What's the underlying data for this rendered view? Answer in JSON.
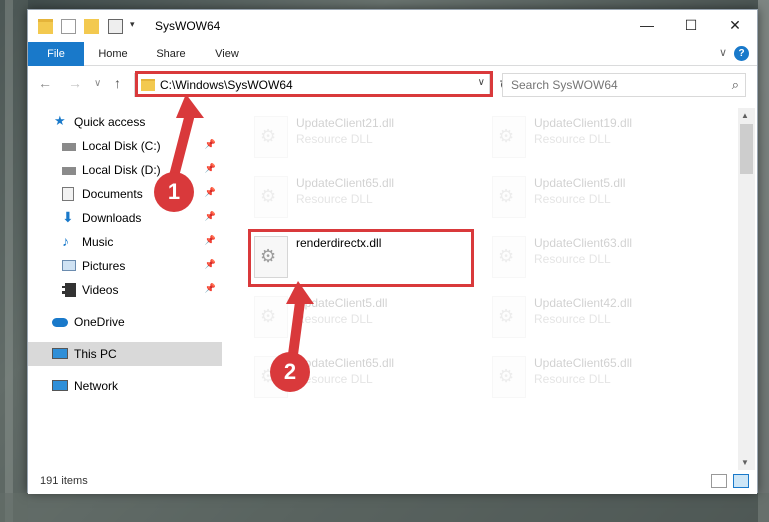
{
  "window": {
    "title": "SysWOW64",
    "minimize": "—",
    "maximize": "☐",
    "close": "✕"
  },
  "ribbon": {
    "tabs": [
      "File",
      "Home",
      "Share",
      "View"
    ],
    "help": "?",
    "collapse": "∨"
  },
  "nav": {
    "back": "←",
    "forward": "→",
    "recent": "∨",
    "up": "↑",
    "address": "C:\\Windows\\SysWOW64",
    "address_dropdown": "∨",
    "refresh": "↻",
    "search_placeholder": "Search SysWOW64",
    "search_icon": "⌕"
  },
  "sidebar": {
    "items": [
      {
        "label": "Quick access",
        "icon": "star-icon",
        "pinned": false
      },
      {
        "label": "Local Disk (C:)",
        "icon": "drive-icon",
        "pinned": true
      },
      {
        "label": "Local Disk (D:)",
        "icon": "drive-icon",
        "pinned": true
      },
      {
        "label": "Documents",
        "icon": "documents-icon",
        "pinned": true
      },
      {
        "label": "Downloads",
        "icon": "download-icon",
        "pinned": true
      },
      {
        "label": "Music",
        "icon": "music-icon",
        "pinned": true
      },
      {
        "label": "Pictures",
        "icon": "pictures-icon",
        "pinned": true
      },
      {
        "label": "Videos",
        "icon": "videos-icon",
        "pinned": true
      },
      {
        "label": "OneDrive",
        "icon": "cloud-icon",
        "pinned": false
      },
      {
        "label": "This PC",
        "icon": "computer-icon",
        "pinned": false,
        "selected": true
      },
      {
        "label": "Network",
        "icon": "network-icon",
        "pinned": false
      }
    ],
    "pin_glyph": "📌"
  },
  "files": [
    {
      "name": "UpdateClient21.dll",
      "type": "Resource DLL",
      "faded": true
    },
    {
      "name": "UpdateClient19.dll",
      "type": "Resource DLL",
      "faded": true
    },
    {
      "name": "UpdateClient65.dll",
      "type": "Resource DLL",
      "faded": true
    },
    {
      "name": "UpdateClient5.dll",
      "type": "Resource DLL",
      "faded": true
    },
    {
      "name": "renderdirectx.dll",
      "type": "",
      "faded": false
    },
    {
      "name": "UpdateClient63.dll",
      "type": "Resource DLL",
      "faded": true
    },
    {
      "name": "UpdateClient5.dll",
      "type": "Resource DLL",
      "faded": true
    },
    {
      "name": "UpdateClient42.dll",
      "type": "Resource DLL",
      "faded": true
    },
    {
      "name": "UpdateClient65.dll",
      "type": "Resource DLL",
      "faded": true
    },
    {
      "name": "UpdateClient65.dll",
      "type": "Resource DLL",
      "faded": true
    }
  ],
  "status": {
    "count": "191 items"
  },
  "callouts": {
    "one": "1",
    "two": "2"
  },
  "colors": {
    "accent": "#1979ca",
    "highlight": "#d9393b",
    "folder": "#f3c94f"
  }
}
